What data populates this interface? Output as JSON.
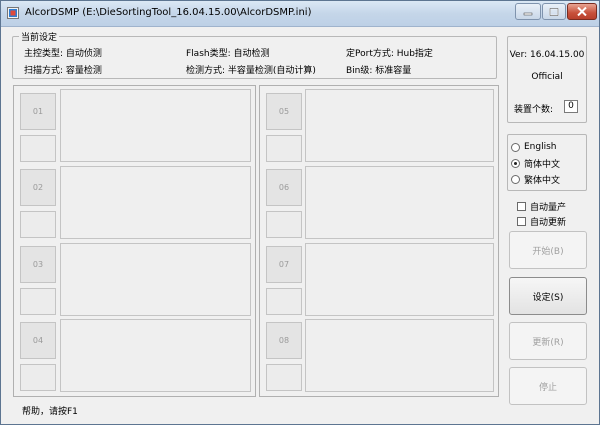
{
  "window": {
    "title": "AlcorDSMP (E:\\DieSortingTool_16.04.15.00\\AlcorDSMP.ini)"
  },
  "settings": {
    "group_title": "当前设定",
    "controller_type": "主控类型: 自动侦测",
    "flash_type": "Flash类型: 自动检测",
    "port_mode": "定Port方式: Hub指定",
    "scan_mode": "扫描方式: 容量检测",
    "check_mode": "检测方式: 半容量检测(自动计算)",
    "bin_level": "Bin级: 标准容量"
  },
  "info": {
    "version": "Ver: 16.04.15.00",
    "edition": "Official",
    "device_count_label": "装置个数:",
    "device_count": "0"
  },
  "language": {
    "options": [
      "English",
      "简体中文",
      "繁体中文"
    ],
    "selected": "简体中文"
  },
  "options": {
    "auto_mass_production": "自动量产",
    "auto_update": "自动更新"
  },
  "buttons": {
    "start": "开始(B)",
    "settings": "设定(S)",
    "update": "更新(R)",
    "stop": "停止"
  },
  "slots": [
    "01",
    "02",
    "03",
    "04",
    "05",
    "06",
    "07",
    "08"
  ],
  "status": "帮助，请按F1"
}
